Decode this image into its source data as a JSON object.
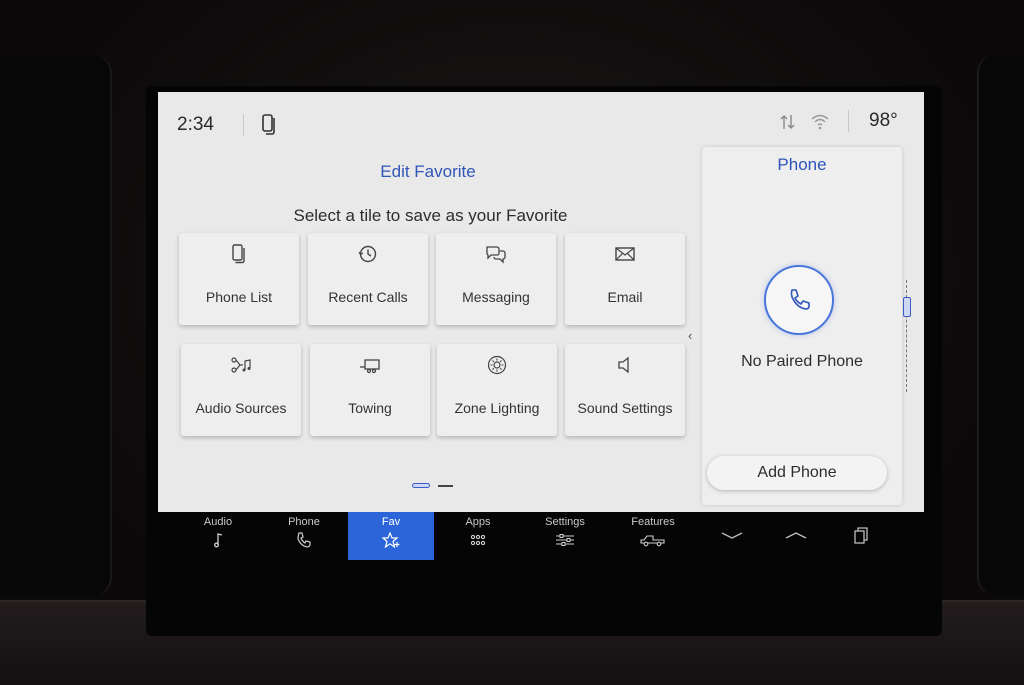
{
  "status_bar": {
    "time": "2:34",
    "temperature": "98°"
  },
  "main": {
    "title": "Edit Favorite",
    "subtitle": "Select a tile to save as your Favorite",
    "tiles": [
      {
        "label": "Phone List",
        "icon": "phone-list-icon"
      },
      {
        "label": "Recent Calls",
        "icon": "recent-calls-icon"
      },
      {
        "label": "Messaging",
        "icon": "messaging-icon"
      },
      {
        "label": "Email",
        "icon": "email-icon"
      },
      {
        "label": "Audio Sources",
        "icon": "audio-sources-icon"
      },
      {
        "label": "Towing",
        "icon": "towing-icon"
      },
      {
        "label": "Zone Lighting",
        "icon": "zone-lighting-icon"
      },
      {
        "label": "Sound Settings",
        "icon": "sound-settings-icon"
      }
    ]
  },
  "phone_panel": {
    "title": "Phone",
    "status": "No Paired Phone",
    "add_button": "Add Phone"
  },
  "navbar": {
    "items": [
      {
        "label": "Audio",
        "icon": "music-note-icon"
      },
      {
        "label": "Phone",
        "icon": "phone-icon"
      },
      {
        "label": "Fav",
        "icon": "star-icon",
        "active": true
      },
      {
        "label": "Apps",
        "icon": "apps-grid-icon"
      },
      {
        "label": "Settings",
        "icon": "settings-sliders-icon"
      },
      {
        "label": "Features",
        "icon": "truck-icon"
      }
    ]
  },
  "colors": {
    "accent": "#2f55b8",
    "active_tab": "#2b65d9",
    "screen_bg": "#e9e9ea"
  }
}
